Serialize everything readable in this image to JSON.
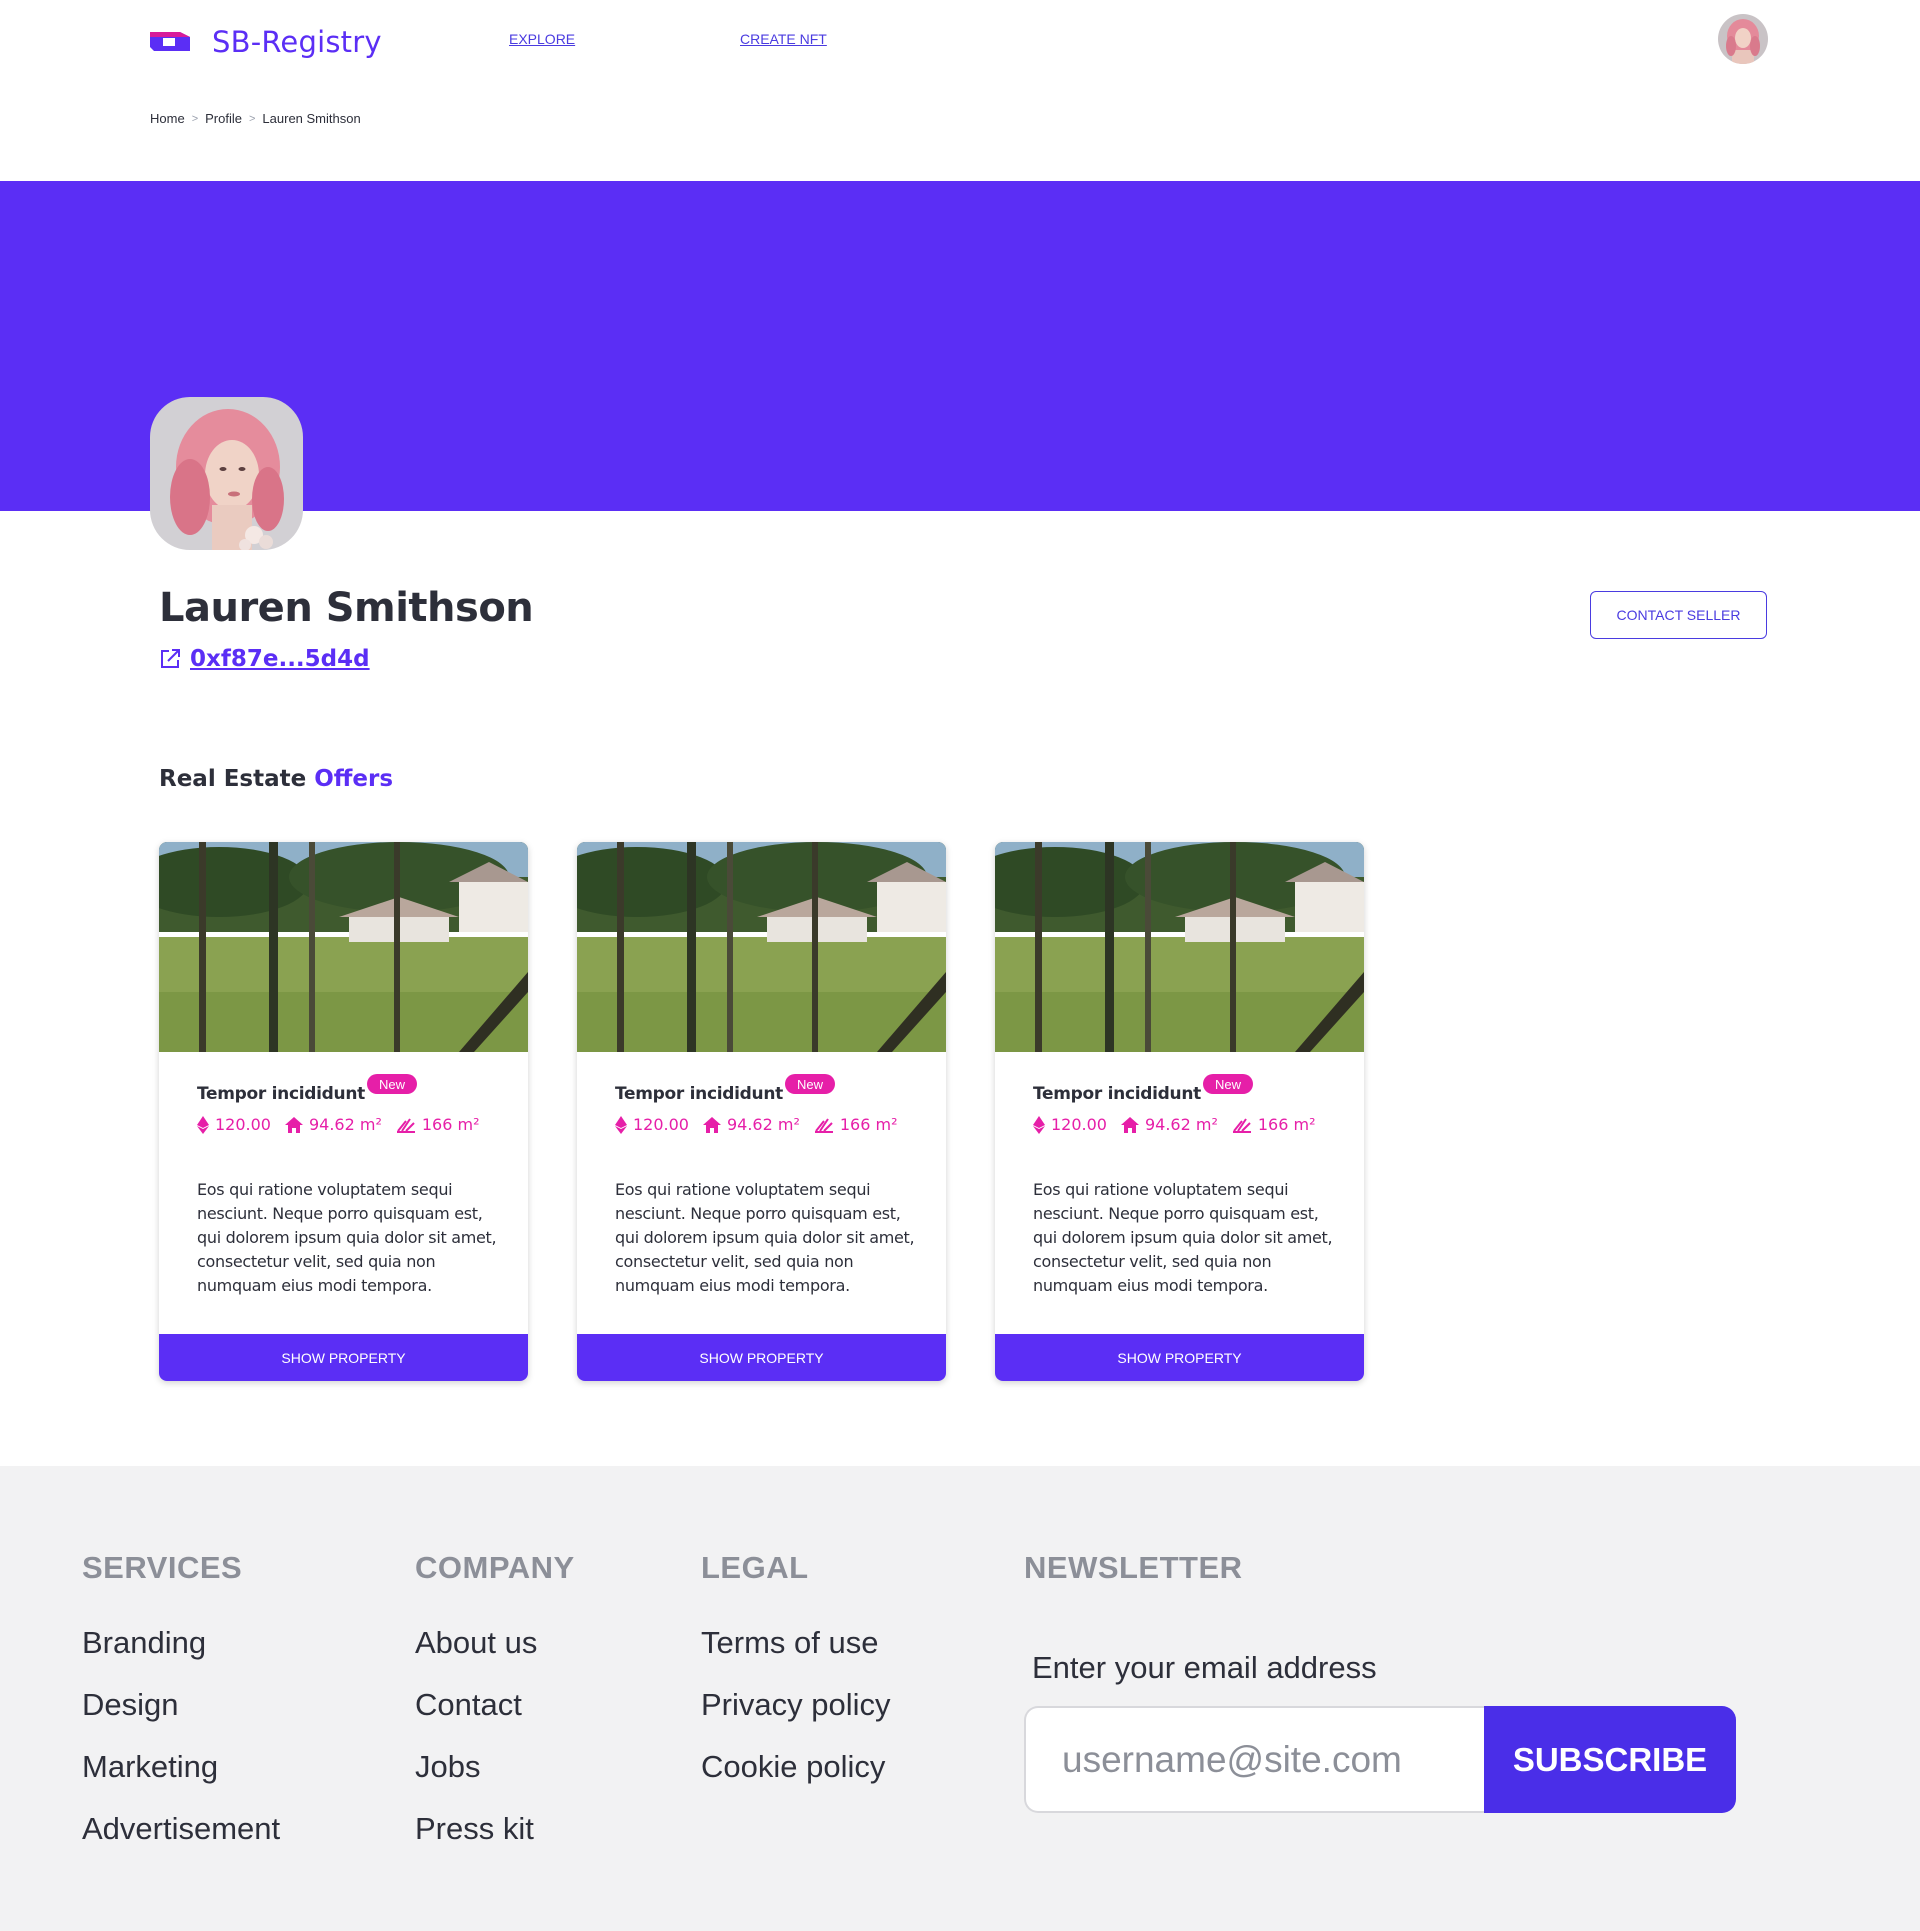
{
  "header": {
    "brand": "SB-Registry",
    "nav": {
      "explore": "EXPLORE",
      "create": "CREATE NFT"
    },
    "logo_icon": "brand-logo-icon",
    "avatar_icon": "user-avatar"
  },
  "breadcrumb": {
    "items": [
      "Home",
      "Profile",
      "Lauren Smithson"
    ],
    "separator": ">"
  },
  "profile": {
    "name": "Lauren Smithson",
    "wallet": "0xf87e...5d4d",
    "contact_label": "CONTACT SELLER",
    "banner_color": "#5b2ef5"
  },
  "section": {
    "title_main": "Real Estate",
    "title_accent": "Offers"
  },
  "cards": [
    {
      "title": "Tempor incididunt",
      "badge": "New",
      "price": "120.00",
      "area": "94.62 m²",
      "land": "166 m²",
      "description": "Eos qui ratione voluptatem sequi nesciunt. Neque porro quisquam est, qui dolorem ipsum quia dolor sit amet, consectetur velit, sed quia non numquam eius modi tempora.",
      "button": "SHOW PROPERTY"
    },
    {
      "title": "Tempor incididunt",
      "badge": "New",
      "price": "120.00",
      "area": "94.62 m²",
      "land": "166 m²",
      "description": "Eos qui ratione voluptatem sequi nesciunt. Neque porro quisquam est, qui dolorem ipsum quia dolor sit amet, consectetur velit, sed quia non numquam eius modi tempora.",
      "button": "SHOW PROPERTY"
    },
    {
      "title": "Tempor incididunt",
      "badge": "New",
      "price": "120.00",
      "area": "94.62 m²",
      "land": "166 m²",
      "description": "Eos qui ratione voluptatem sequi nesciunt. Neque porro quisquam est, qui dolorem ipsum quia dolor sit amet, consectetur velit, sed quia non numquam eius modi tempora.",
      "button": "SHOW PROPERTY"
    }
  ],
  "footer": {
    "services": {
      "heading": "SERVICES",
      "items": [
        "Branding",
        "Design",
        "Marketing",
        "Advertisement"
      ]
    },
    "company": {
      "heading": "COMPANY",
      "items": [
        "About us",
        "Contact",
        "Jobs",
        "Press kit"
      ]
    },
    "legal": {
      "heading": "LEGAL",
      "items": [
        "Terms of use",
        "Privacy policy",
        "Cookie policy"
      ]
    },
    "newsletter": {
      "heading": "NEWSLETTER",
      "label": "Enter your email address",
      "placeholder": "username@site.com",
      "button": "SUBSCRIBE"
    }
  },
  "colors": {
    "accent": "#5b2ef5",
    "pink": "#e61fa8",
    "footer_bg": "#f2f2f3"
  }
}
